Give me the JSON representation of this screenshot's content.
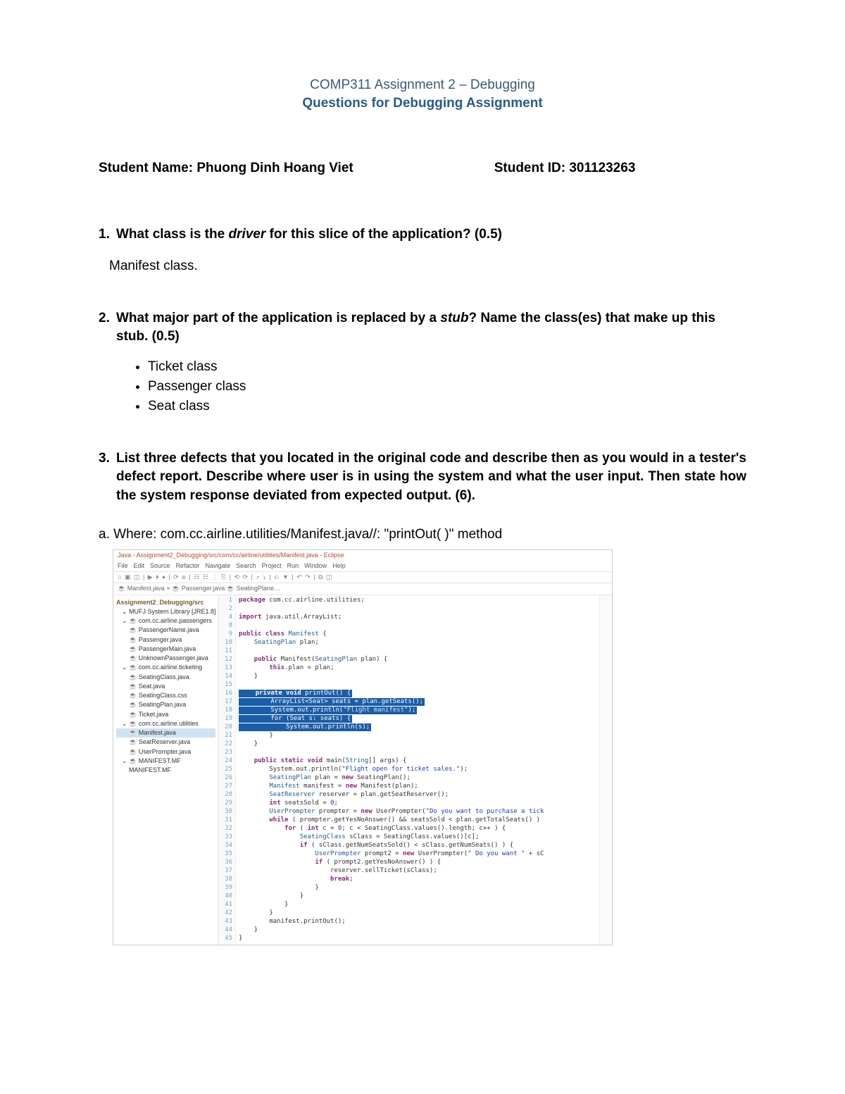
{
  "header": {
    "line1": "COMP311 Assignment 2 – Debugging",
    "line2": "Questions for Debugging Assignment"
  },
  "student": {
    "name_label": "Student Name:",
    "name_value": "Phuong Dinh Hoang Viet",
    "id_label": "Student ID:",
    "id_value": "301123263"
  },
  "q1": {
    "num": "1.",
    "text_before": "What class is the ",
    "text_em": "driver",
    "text_after": " for this slice of the application? (0.5)",
    "answer": "Manifest class."
  },
  "q2": {
    "num": "2.",
    "text_before": "What major part of the application is replaced by a ",
    "text_em": "stub",
    "text_after": "? Name the class(es) that make up this stub. (0.5)",
    "bullets": [
      "Ticket class",
      "Passenger class",
      "Seat class"
    ]
  },
  "q3": {
    "num": "3.",
    "text": "List three defects that you located in the original code and describe then as you would in a tester's defect report. Describe where user is in using the system and what the user input. Then state how the system response deviated from expected output. (6).",
    "sub_a_label": "a.",
    "sub_a_text": "Where: com.cc.airline.utilities/Manifest.java//: \"printOut( )\" method"
  },
  "ide": {
    "title": "Java - Assignment2_Debugging/src/com/cc/airline/utilities/Manifest.java - Eclipse",
    "menus": [
      "File",
      "Edit",
      "Source",
      "Refactor",
      "Navigate",
      "Search",
      "Project",
      "Run",
      "Window",
      "Help"
    ],
    "toolbar_glyphs": "⌂ ▣ ◫ | ▶ ⏵ ♦ | ⟳ ⧈ | ☷ ☷ ⋮ ⎘ | ⟲ ⟳ | ⤴ ⤵ | ⎌ ▼ | ↶ ↷ | ⧉ ◫",
    "tabs_text": "☕ Manifest.java ×    ☕ Passenger.java    ☕ SeatingPlane…",
    "tree": [
      {
        "lvl": 0,
        "label": "Assignment2_Debugging/src"
      },
      {
        "lvl": 1,
        "label": "⌄ MUFJ System Library [JRE1.8]"
      },
      {
        "lvl": 1,
        "label": "⌄ ☕ com.cc.airline.passengers"
      },
      {
        "lvl": 2,
        "label": "☕ PassengerName.java"
      },
      {
        "lvl": 2,
        "label": "☕ Passenger.java"
      },
      {
        "lvl": 2,
        "label": "☕ PassengerMain.java"
      },
      {
        "lvl": 2,
        "label": "☕ UnknownPassenger.java"
      },
      {
        "lvl": 1,
        "label": "⌄ ☕ com.cc.airline.ticketing"
      },
      {
        "lvl": 2,
        "label": "☕ SeatingClass.java"
      },
      {
        "lvl": 2,
        "label": "☕ Seat.java"
      },
      {
        "lvl": 2,
        "label": "☕ SeatingClass.css"
      },
      {
        "lvl": 2,
        "label": "☕ SeatingPlan.java"
      },
      {
        "lvl": 2,
        "label": "☕ Ticket.java"
      },
      {
        "lvl": 1,
        "label": "⌄ ☕ com.cc.airline.utilities",
        "selected": false
      },
      {
        "lvl": 2,
        "label": "☕ Manifest.java",
        "selected": true
      },
      {
        "lvl": 2,
        "label": "☕ SeatReserver.java"
      },
      {
        "lvl": 2,
        "label": "☕ UserPrompter.java"
      },
      {
        "lvl": 1,
        "label": "⌄ ☕ MANIFEST.MF"
      },
      {
        "lvl": 2,
        "label": "MANIFEST.MF"
      }
    ],
    "code": [
      {
        "n": 1,
        "html": "<span class='kw'>package</span> com.cc.airline.utilities;"
      },
      {
        "n": 2,
        "html": ""
      },
      {
        "n": 4,
        "html": "<span class='kw'>import</span> java.util.ArrayList;"
      },
      {
        "n": 8,
        "html": ""
      },
      {
        "n": 9,
        "html": "<span class='kw'>public class</span> <span class='type'>Manifest</span> {"
      },
      {
        "n": 10,
        "html": "    <span class='type'>SeatingPlan</span> plan;"
      },
      {
        "n": 11,
        "html": ""
      },
      {
        "n": 12,
        "html": "    <span class='kw'>public</span> Manifest(<span class='type'>SeatingPlan</span> plan) {"
      },
      {
        "n": 13,
        "html": "        <span class='kw'>this</span>.plan = plan;"
      },
      {
        "n": 14,
        "html": "    }"
      },
      {
        "n": 15,
        "html": ""
      },
      {
        "n": 16,
        "html": "<span class='hl'>    <span class='kw' style='color:#fff'>private void</span> printOut() {</span>"
      },
      {
        "n": 17,
        "html": "<span class='hl'>        ArrayList&lt;Seat&gt; seats = plan.getSeats();</span>"
      },
      {
        "n": 18,
        "html": "<span class='hl'>        System.out.println(<span class='hlstr'>\"Flight manifest\"</span>);</span>"
      },
      {
        "n": 19,
        "html": "<span class='hl'>        <span style='color:#fff'>for</span> (Seat s: seats) {</span>"
      },
      {
        "n": 20,
        "html": "<span class='hl'>            System.out.println(s);</span>"
      },
      {
        "n": 21,
        "html": "        }"
      },
      {
        "n": 22,
        "html": "    }"
      },
      {
        "n": 23,
        "html": ""
      },
      {
        "n": 24,
        "html": "    <span class='kw'>public static void</span> main(<span class='type'>String</span>[] args) {"
      },
      {
        "n": 25,
        "html": "        System.out.println(<span class='str'>\"Flight open for ticket sales.\"</span>);"
      },
      {
        "n": 26,
        "html": "        <span class='type'>SeatingPlan</span> plan = <span class='kw'>new</span> SeatingPlan();"
      },
      {
        "n": 27,
        "html": "        <span class='type'>Manifest</span> manifest = <span class='kw'>new</span> Manifest(plan);"
      },
      {
        "n": 28,
        "html": "        <span class='type'>SeatReserver</span> reserver = plan.getSeatReserver();"
      },
      {
        "n": 29,
        "html": "        <span class='kw'>int</span> seatsSold = <span class='num'>0</span>;"
      },
      {
        "n": 30,
        "html": "        <span class='type'>UserPrompter</span> prompter = <span class='kw'>new</span> UserPrompter(<span class='str'>\"Do you want to purchase a tick</span>"
      },
      {
        "n": 31,
        "html": "        <span class='kw'>while</span> ( prompter.getYesNoAnswer() && seatsSold &lt; plan.getTotalSeats() )"
      },
      {
        "n": 32,
        "html": "            <span class='kw'>for</span> ( <span class='kw'>int</span> c = <span class='num'>0</span>; c &lt; SeatingClass.values().length; c++ ) {"
      },
      {
        "n": 33,
        "html": "                <span class='type'>SeatingClass</span> sClass = SeatingClass.values()[c];"
      },
      {
        "n": 34,
        "html": "                <span class='kw'>if</span> ( sClass.getNumSeatsSold() &lt; sClass.getNumSeats() ) {"
      },
      {
        "n": 35,
        "html": "                    <span class='type'>UserPrompter</span> prompt2 = <span class='kw'>new</span> UserPrompter(<span class='str'>\" Do you want \"</span> + sC"
      },
      {
        "n": 36,
        "html": "                    <span class='kw'>if</span> ( prompt2.getYesNoAnswer() ) {"
      },
      {
        "n": 37,
        "html": "                        reserver.sellTicket(sClass);"
      },
      {
        "n": 38,
        "html": "                        <span class='kw'>break</span>;"
      },
      {
        "n": 39,
        "html": "                    }"
      },
      {
        "n": 40,
        "html": "                }"
      },
      {
        "n": 41,
        "html": "            }"
      },
      {
        "n": 42,
        "html": "        }"
      },
      {
        "n": 43,
        "html": "        manifest.printOut();"
      },
      {
        "n": 44,
        "html": "    }"
      },
      {
        "n": 45,
        "html": "}"
      }
    ]
  }
}
